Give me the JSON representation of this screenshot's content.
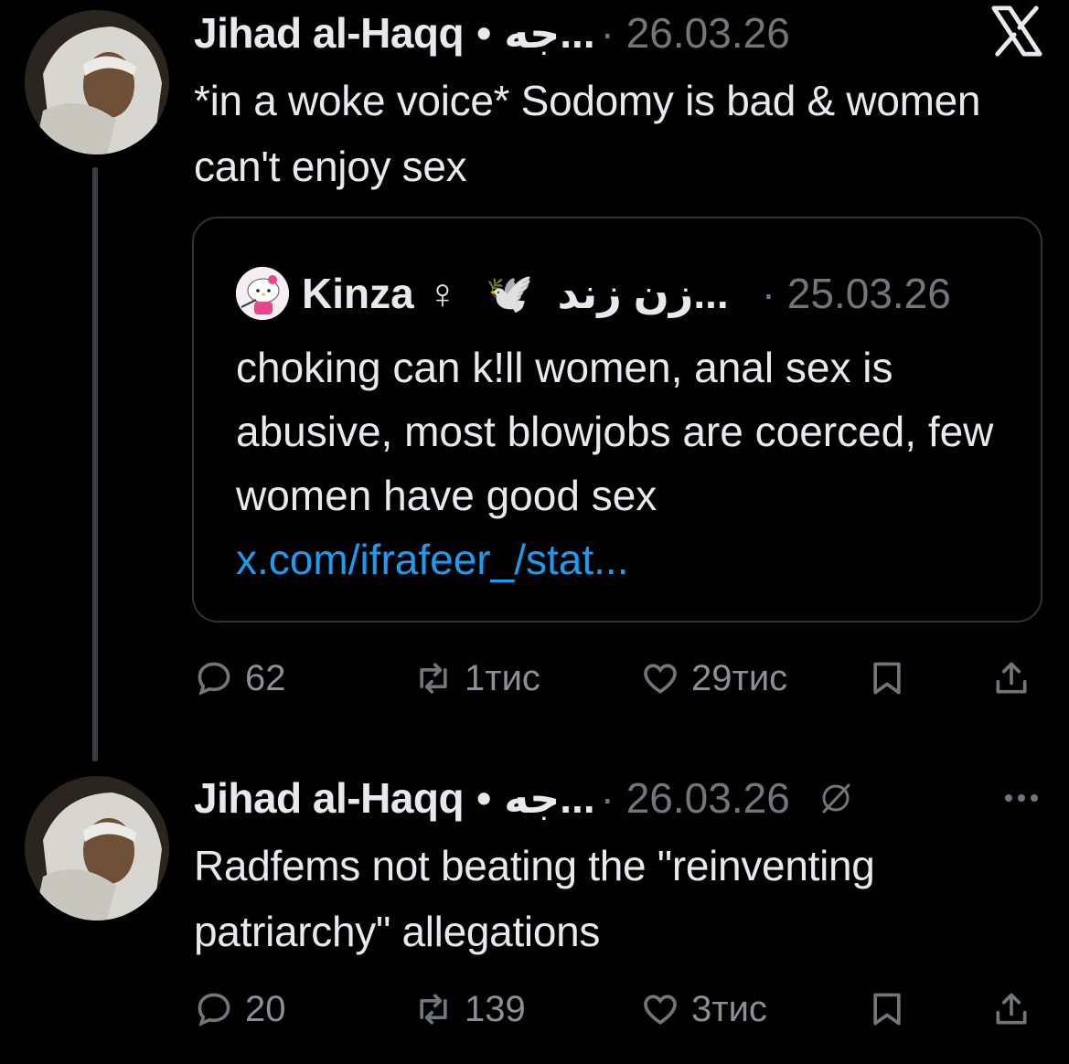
{
  "tweets": [
    {
      "author": "Jihad al-Haqq",
      "separator": "•",
      "arabic_handle": "جه...",
      "date": "· 26.03.26",
      "text": "*in a woke voice* Sodomy is bad & women can't enjoy sex",
      "quote": {
        "author": "Kinza",
        "female_sign": "♀",
        "dove": "🕊️",
        "arabic_name": "زن زند...",
        "date": "· 25.03.26",
        "text": "choking can k!ll women, anal sex is abusive, most blowjobs are coerced, few women have good sex",
        "link": "x.com/ifrafeer_/stat..."
      },
      "actions": {
        "replies": "62",
        "retweets": "1тис",
        "likes": "29тис"
      }
    },
    {
      "author": "Jihad al-Haqq",
      "separator": "•",
      "arabic_handle": "جه...",
      "date": "· 26.03.26",
      "text": "Radfems not beating the \"reinventing patriarchy\" allegations",
      "actions": {
        "replies": "20",
        "retweets": "139",
        "likes": "3тис"
      }
    }
  ],
  "icons": {
    "reply": "reply-icon",
    "retweet": "retweet-icon",
    "like": "heart-icon",
    "bookmark": "bookmark-icon",
    "share": "share-icon",
    "logo": "x-logo-icon",
    "grok": "grok-icon",
    "more": "more-icon"
  },
  "colors": {
    "background": "#000000",
    "text": "#e7e9ea",
    "muted": "#71767b",
    "link": "#1d9bf0",
    "border": "#2f3336"
  }
}
